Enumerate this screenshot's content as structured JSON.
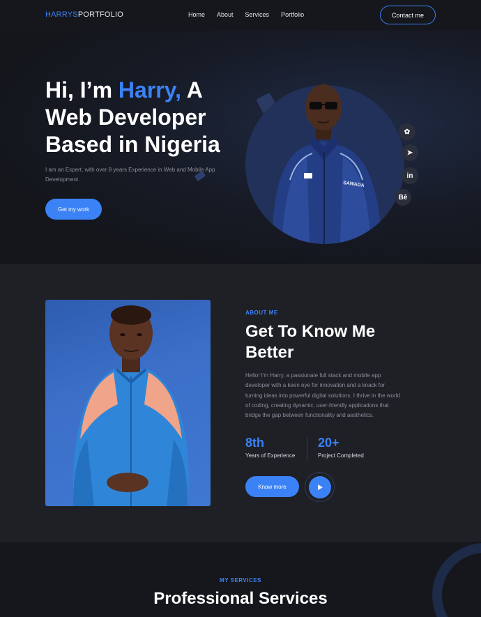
{
  "nav": {
    "logo_part1": "HARRYS",
    "logo_part2": "PORTFOLIO",
    "links": [
      "Home",
      "About",
      "Services",
      "Portfolio"
    ],
    "contact_label": "Contact me"
  },
  "hero": {
    "title_line1_prefix": "Hi, I’m ",
    "title_line1_accent": "Harry,",
    "title_line1_suffix": " A",
    "title_line2": "Web Developer",
    "title_line3": "Based in Nigeria",
    "subtitle": "I am an Expert, with over 8 years Experience in Web and Mobile App Development.",
    "cta_label": "Get my work",
    "shirt_text": "SAWADA",
    "social": [
      {
        "icon": "dribbble-icon",
        "glyph": "✿"
      },
      {
        "icon": "telegram-icon",
        "glyph": "➤"
      },
      {
        "icon": "linkedin-icon",
        "glyph": "in"
      },
      {
        "icon": "behance-icon",
        "glyph": "Bē"
      }
    ]
  },
  "about": {
    "kicker": "ABOUT ME",
    "title": "Get To Know Me Better",
    "body": "Hello! I'm Harry, a passionate full stack and mobile app developer with a keen eye for innovation and a knack for turning ideas into powerful digital solutions. I thrive in the world of coding, creating dynamic, user-friendly applications that bridge the gap between functionality and aesthetics.",
    "stats": [
      {
        "value": "8th",
        "label": "Years of Experience"
      },
      {
        "value": "20+",
        "label": "Project Completed"
      }
    ],
    "cta_label": "Know more"
  },
  "services": {
    "kicker": "MY SERVICES",
    "title": "Professional Services"
  },
  "colors": {
    "accent": "#3b82f6",
    "background": "#15171c",
    "section_alt": "#1e2026"
  }
}
